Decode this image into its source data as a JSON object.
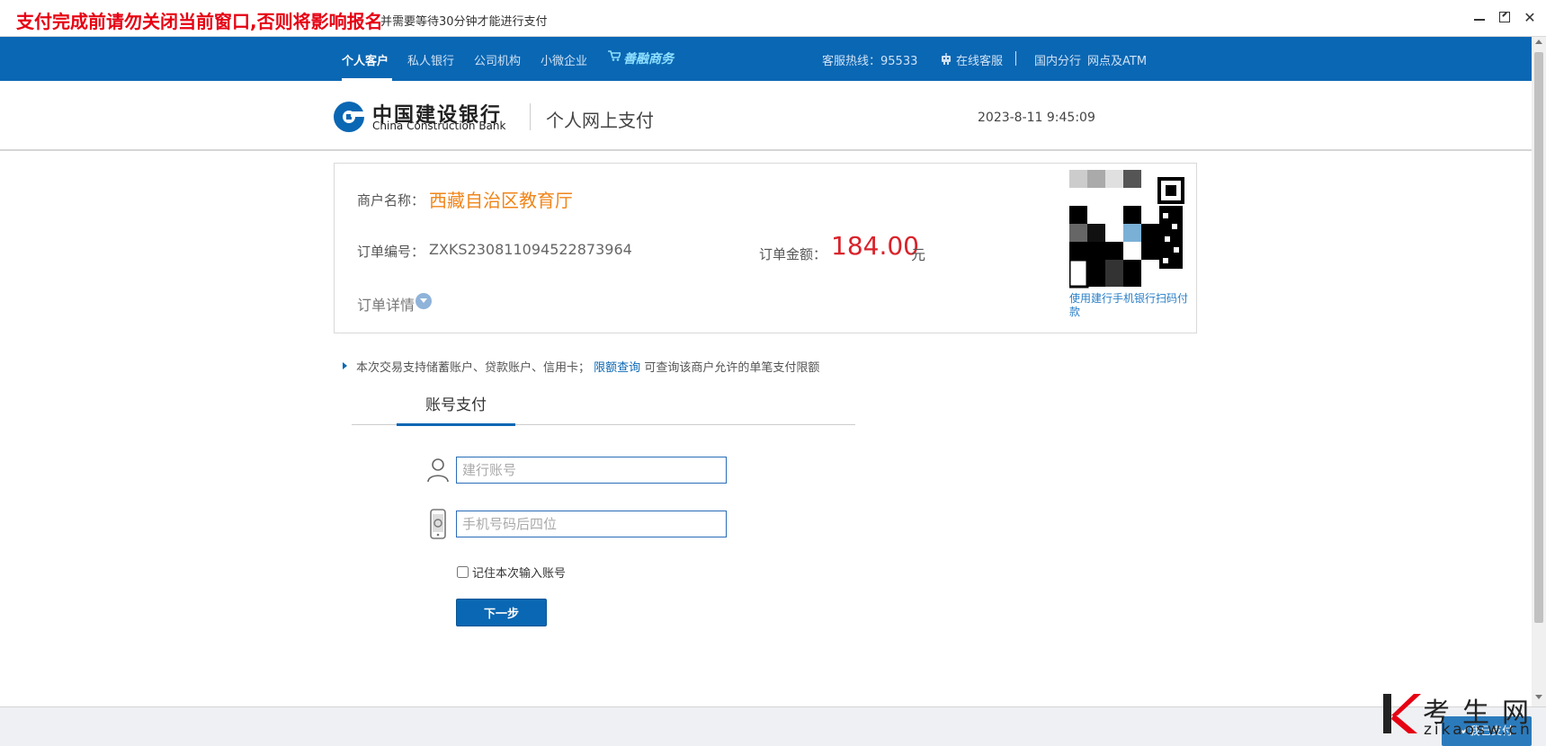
{
  "window": {
    "warning": "支付完成前请勿关闭当前窗口,否则将影响报名",
    "subtitle": "并需要等待30分钟才能进行支付",
    "close_glyph": "✕"
  },
  "nav": {
    "items": [
      "个人客户",
      "私人银行",
      "公司机构",
      "小微企业",
      "善融商务"
    ],
    "hotline": "客服热线：95533",
    "online_service": "在线客服",
    "branches": "国内分行",
    "atm": "网点及ATM"
  },
  "header": {
    "bank_name_cn": "中国建设银行",
    "bank_name_en": "China Construction Bank",
    "title": "个人网上支付",
    "datetime": "2023-8-11 9:45:09"
  },
  "order": {
    "merchant_label": "商户名称：",
    "merchant_name": "西藏自治区教育厅",
    "order_no_label": "订单编号：",
    "order_no": "ZXKS230811094522873964",
    "amount_label": "订单金额：",
    "amount": "184.00",
    "currency": "元",
    "detail_label": "订单详情",
    "qr_caption": "使用建行手机银行扫码付款"
  },
  "info": {
    "text": "本次交易支持储蓄账户、贷款账户、信用卡；",
    "link": "限额查询",
    "suffix": "可查询该商户允许的单笔支付限额"
  },
  "tabs": [
    "账号支付"
  ],
  "form": {
    "account_placeholder": "建行账号",
    "phone_placeholder": "手机号码后四位",
    "remember_label": "记住本次输入账号",
    "next_label": "下一步"
  },
  "watermark": {
    "brand": "考生网",
    "url": "zikaosw.cn",
    "button": "✔我已支付"
  },
  "colors": {
    "brand_blue": "#0a67b3",
    "warning_red": "#e60012",
    "merchant_orange": "#f08519",
    "amount_red": "#d9222a"
  }
}
